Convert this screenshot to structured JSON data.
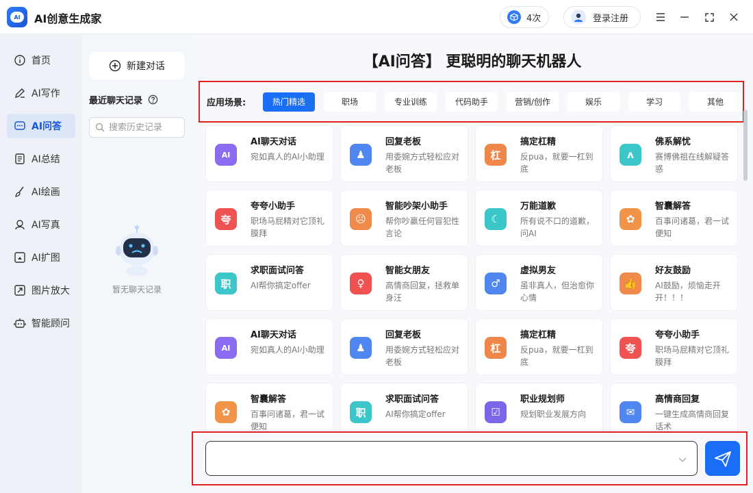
{
  "app": {
    "title": "AI创意生成家",
    "logo_text": "AI"
  },
  "header": {
    "credits": "4次",
    "login_label": "登录注册"
  },
  "nav": {
    "items": [
      {
        "label": "首页",
        "icon": "info-circle-icon"
      },
      {
        "label": "AI写作",
        "icon": "pen-icon"
      },
      {
        "label": "AI问答",
        "icon": "chat-bubble-icon",
        "active": true
      },
      {
        "label": "AI总结",
        "icon": "document-icon"
      },
      {
        "label": "AI绘画",
        "icon": "brush-icon"
      },
      {
        "label": "AI写真",
        "icon": "portrait-icon"
      },
      {
        "label": "AI扩图",
        "icon": "expand-image-icon"
      },
      {
        "label": "图片放大",
        "icon": "zoom-image-icon"
      },
      {
        "label": "智能顾问",
        "icon": "robot-icon"
      }
    ]
  },
  "history": {
    "new_chat_label": "新建对话",
    "recent_title": "最近聊天记录",
    "search_placeholder": "搜索历史记录",
    "empty_text": "暂无聊天记录"
  },
  "main": {
    "title": "【AI问答】 更聪明的聊天机器人",
    "scene_label": "应用场景:",
    "scenes": [
      "热门精选",
      "职场",
      "专业训练",
      "代码助手",
      "营销/创作",
      "娱乐",
      "学习",
      "其他"
    ],
    "active_scene": 0
  },
  "cards": [
    {
      "title": "AI聊天对话",
      "desc": "宛如真人的AI小助理",
      "icon": "chat-ai-icon",
      "color": "#8b6cf0",
      "glyph": "AI"
    },
    {
      "title": "回复老板",
      "desc": "用委婉方式轻松应对老板",
      "icon": "boss-icon",
      "color": "#4f86f0",
      "glyph": "♟"
    },
    {
      "title": "搞定杠精",
      "desc": "反pua，就要一杠到底",
      "icon": "bar-icon",
      "color": "#f0874a",
      "glyph": "杠"
    },
    {
      "title": "佛系解忧",
      "desc": "赛博佛祖在线解疑答惑",
      "icon": "buddha-hands-icon",
      "color": "#3cc6c9",
      "glyph": "ʌ"
    },
    {
      "title": "夸夸小助手",
      "desc": "职场马屁精对它顶礼膜拜",
      "icon": "praise-icon",
      "color": "#f05252",
      "glyph": "夸"
    },
    {
      "title": "智能吵架小助手",
      "desc": "帮你吵赢任何冒犯性言论",
      "icon": "angry-face-icon",
      "color": "#f08a4a",
      "glyph": "☹"
    },
    {
      "title": "万能道歉",
      "desc": "所有说不口的道歉，问AI",
      "icon": "apology-icon",
      "color": "#3cc6c9",
      "glyph": "☾"
    },
    {
      "title": "智囊解答",
      "desc": "百事问诸葛，君一试便知",
      "icon": "wisdom-bag-icon",
      "color": "#f0944a",
      "glyph": "✿"
    },
    {
      "title": "求职面试问答",
      "desc": "AI帮你搞定offer",
      "icon": "job-icon",
      "color": "#3cc6c9",
      "glyph": "职"
    },
    {
      "title": "智能女朋友",
      "desc": "高情商回复，拯救单身汪",
      "icon": "girlfriend-icon",
      "color": "#f05252",
      "glyph": "♀"
    },
    {
      "title": "虚拟男友",
      "desc": "虽非真人，但治愈你心情",
      "icon": "boyfriend-icon",
      "color": "#4f86f0",
      "glyph": "♂"
    },
    {
      "title": "好友鼓励",
      "desc": "AI鼓励，烦恼走开开！！！",
      "icon": "thumbs-up-icon",
      "color": "#f08a4a",
      "glyph": "👍"
    },
    {
      "title": "AI聊天对话",
      "desc": "宛如真人的AI小助理",
      "icon": "chat-ai-icon",
      "color": "#8b6cf0",
      "glyph": "AI"
    },
    {
      "title": "回复老板",
      "desc": "用委婉方式轻松应对老板",
      "icon": "boss-icon",
      "color": "#4f86f0",
      "glyph": "♟"
    },
    {
      "title": "搞定杠精",
      "desc": "反pua，就要一杠到底",
      "icon": "bar-icon",
      "color": "#f0874a",
      "glyph": "杠"
    },
    {
      "title": "夸夸小助手",
      "desc": "职场马屁精对它顶礼膜拜",
      "icon": "praise-icon",
      "color": "#f05252",
      "glyph": "夸"
    },
    {
      "title": "智囊解答",
      "desc": "百事问诸葛，君一试便知",
      "icon": "wisdom-bag-icon",
      "color": "#f0944a",
      "glyph": "✿"
    },
    {
      "title": "求职面试问答",
      "desc": "AI帮你搞定offer",
      "icon": "job-icon",
      "color": "#3cc6c9",
      "glyph": "职"
    },
    {
      "title": "职业规划师",
      "desc": "规划职业发展方向",
      "icon": "calendar-icon",
      "color": "#7a66e8",
      "glyph": "☑"
    },
    {
      "title": "高情商回复",
      "desc": "一键生成高情商回复话术",
      "icon": "message-box-icon",
      "color": "#4f86f0",
      "glyph": "✉"
    }
  ],
  "chat": {
    "input_value": "",
    "placeholder": ""
  }
}
